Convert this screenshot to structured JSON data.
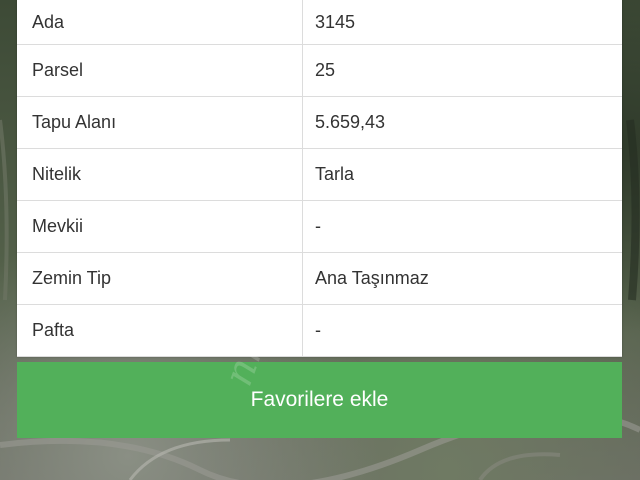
{
  "parcel_table": {
    "rows": [
      {
        "label": "Ada",
        "value": "3145"
      },
      {
        "label": "Parsel",
        "value": "25"
      },
      {
        "label": "Tapu Alanı",
        "value": "5.659,43"
      },
      {
        "label": "Nitelik",
        "value": "Tarla"
      },
      {
        "label": "Mevkii",
        "value": "-"
      },
      {
        "label": "Zemin Tip",
        "value": "Ana Taşınmaz"
      },
      {
        "label": "Pafta",
        "value": "-"
      }
    ]
  },
  "actions": {
    "favorite_label": "Favorilere ekle"
  },
  "colors": {
    "button_green": "#52b05a",
    "row_border": "#dcdcdc"
  }
}
